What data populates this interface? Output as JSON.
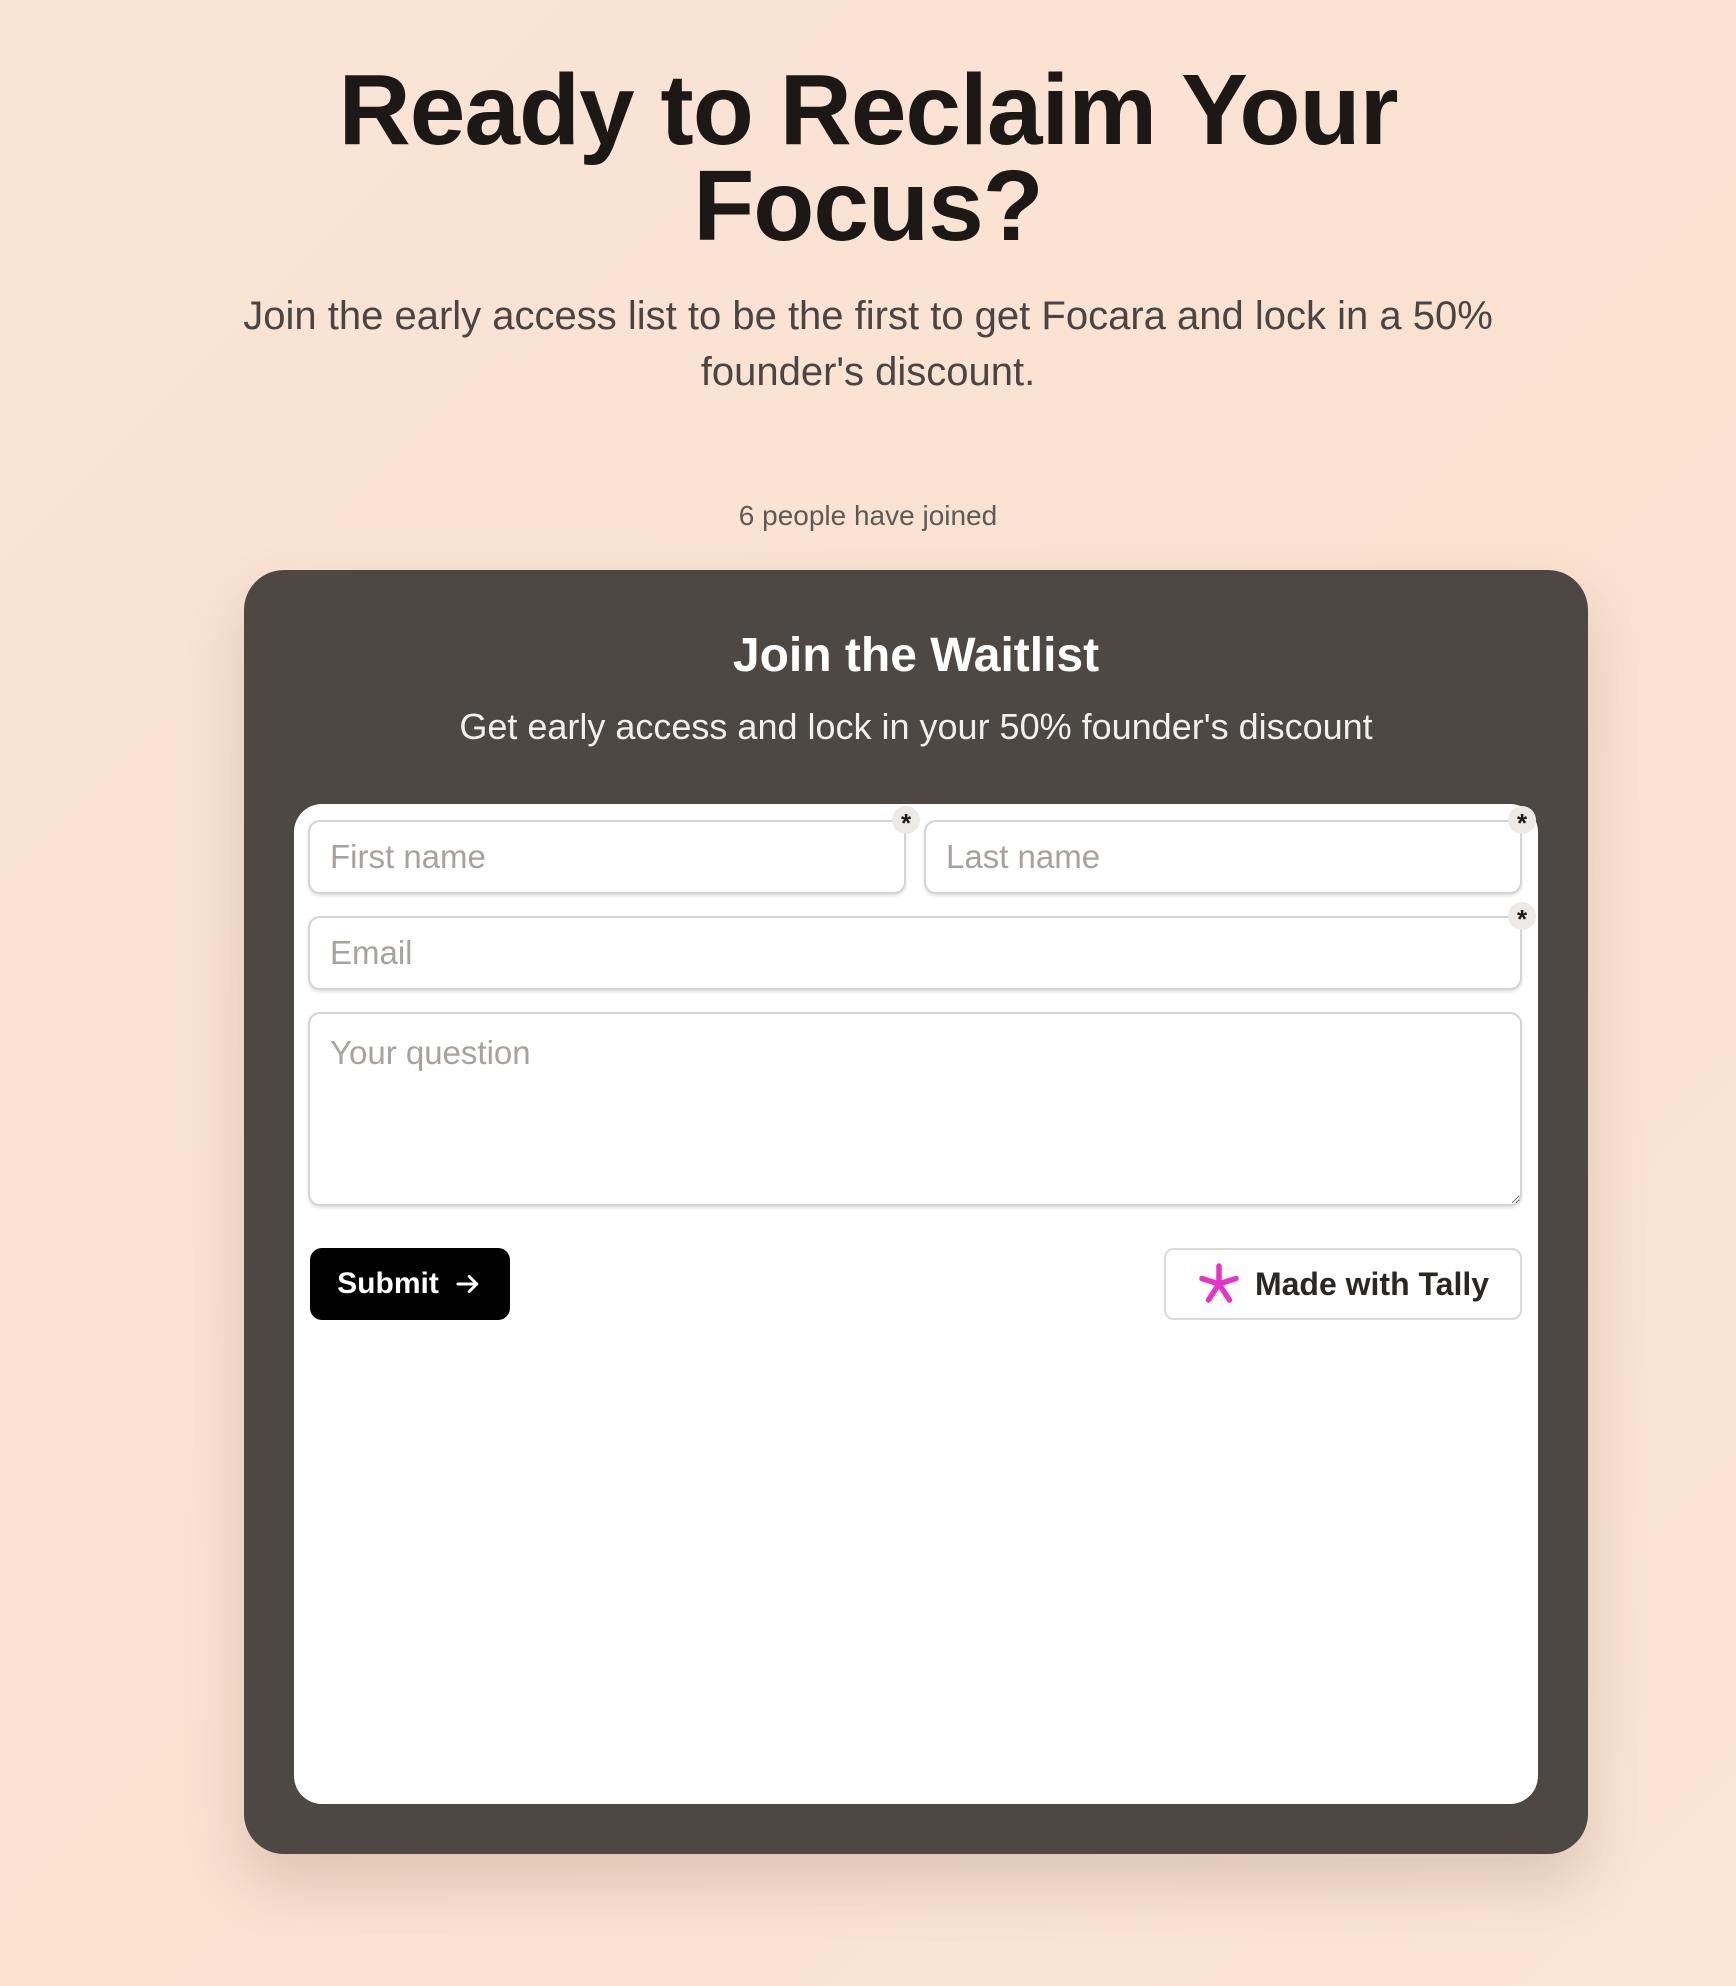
{
  "hero": {
    "title": "Ready to Reclaim Your Focus?",
    "subtitle": "Join the early access list to be the first to get Focara and lock in a 50% founder's discount."
  },
  "join_count": "6 people have joined",
  "card": {
    "title": "Join the Waitlist",
    "subtitle": "Get early access and lock in your 50% founder's discount"
  },
  "form": {
    "first_name": {
      "placeholder": "First name",
      "value": "",
      "required_mark": "*"
    },
    "last_name": {
      "placeholder": "Last name",
      "value": "",
      "required_mark": "*"
    },
    "email": {
      "placeholder": "Email",
      "value": "",
      "required_mark": "*"
    },
    "question": {
      "placeholder": "Your question",
      "value": ""
    },
    "submit_label": "Submit",
    "submit_icon": "arrow-right-icon"
  },
  "badge": {
    "label": "Made with Tally",
    "icon": "tally-asterisk-icon",
    "icon_color": "#e535c8"
  },
  "colors": {
    "background": "#fae2d1",
    "card": "#4d4844",
    "button": "#000000"
  }
}
